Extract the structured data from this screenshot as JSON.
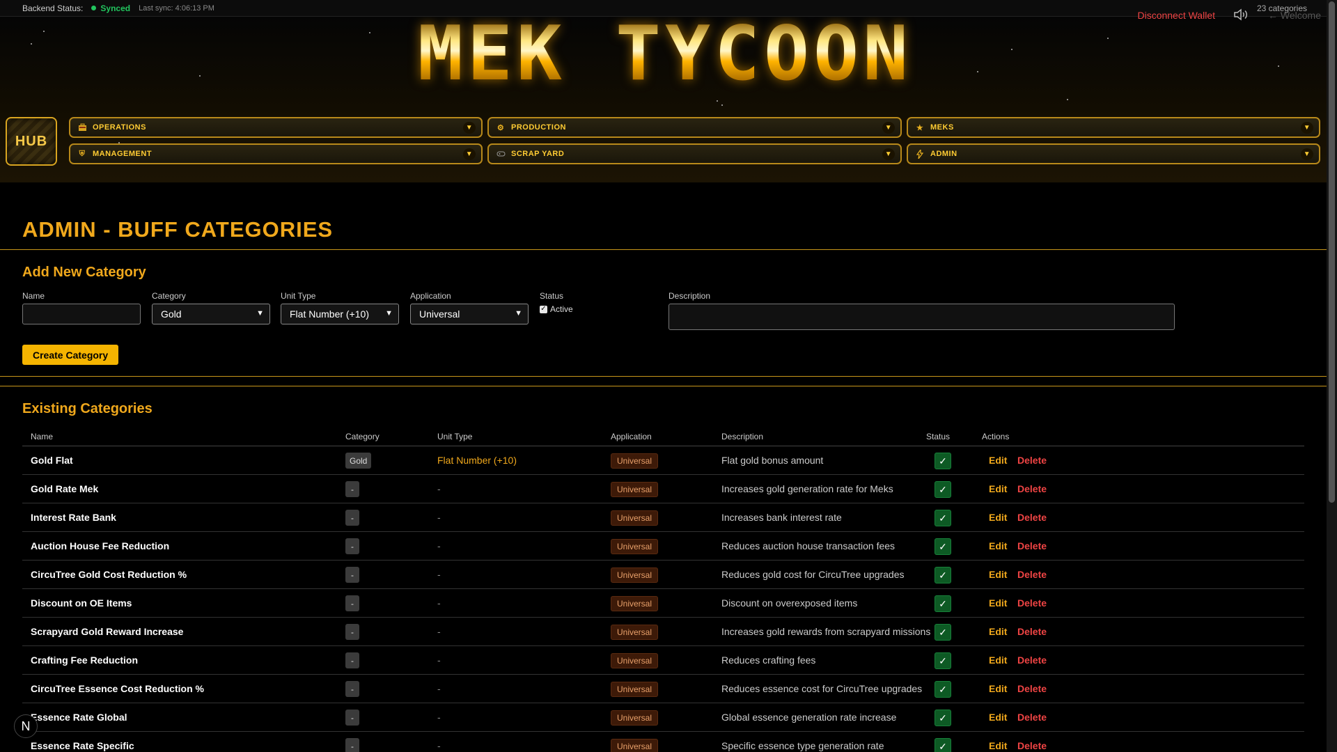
{
  "status_bar": {
    "label": "Backend Status:",
    "status": "Synced",
    "last_sync": "Last sync: 4:06:13 PM"
  },
  "top_right": {
    "disconnect_label": "Disconnect Wallet",
    "welcome_label": "← Welcome",
    "category_count": "23 categories"
  },
  "header": {
    "logo_text": "MEK TYCOON"
  },
  "nav": {
    "hub_label": "HUB",
    "items": [
      {
        "label": "OPERATIONS",
        "icon": "briefcase-icon"
      },
      {
        "label": "PRODUCTION",
        "icon": "gear-icon"
      },
      {
        "label": "MEKS",
        "icon": "star-icon"
      },
      {
        "label": "MANAGEMENT",
        "icon": "shield-icon"
      },
      {
        "label": "SCRAP YARD",
        "icon": "gamepad-icon"
      },
      {
        "label": "ADMIN",
        "icon": "bolt-icon"
      }
    ]
  },
  "page": {
    "title": "ADMIN - BUFF CATEGORIES"
  },
  "form": {
    "title": "Add New Category",
    "name_label": "Name",
    "name_value": "",
    "category_label": "Category",
    "category_value": "Gold",
    "unit_type_label": "Unit Type",
    "unit_type_value": "Flat Number (+10)",
    "application_label": "Application",
    "application_value": "Universal",
    "status_label": "Status",
    "active_label": "Active",
    "active_checked": true,
    "description_label": "Description",
    "description_value": "",
    "create_button": "Create Category"
  },
  "table": {
    "title": "Existing Categories",
    "columns": [
      "Name",
      "Category",
      "Unit Type",
      "Application",
      "Description",
      "Status",
      "Actions"
    ],
    "edit_label": "Edit",
    "delete_label": "Delete",
    "rows": [
      {
        "name": "Gold Flat",
        "category": "Gold",
        "unit_type": "Flat Number (+10)",
        "application": "Universal",
        "description": "Flat gold bonus amount",
        "status": "✓"
      },
      {
        "name": "Gold Rate Mek",
        "category": "-",
        "unit_type": "-",
        "application": "Universal",
        "description": "Increases gold generation rate for Meks",
        "status": "✓"
      },
      {
        "name": "Interest Rate Bank",
        "category": "-",
        "unit_type": "-",
        "application": "Universal",
        "description": "Increases bank interest rate",
        "status": "✓"
      },
      {
        "name": "Auction House Fee Reduction",
        "category": "-",
        "unit_type": "-",
        "application": "Universal",
        "description": "Reduces auction house transaction fees",
        "status": "✓"
      },
      {
        "name": "CircuTree Gold Cost Reduction %",
        "category": "-",
        "unit_type": "-",
        "application": "Universal",
        "description": "Reduces gold cost for CircuTree upgrades",
        "status": "✓"
      },
      {
        "name": "Discount on OE Items",
        "category": "-",
        "unit_type": "-",
        "application": "Universal",
        "description": "Discount on overexposed items",
        "status": "✓"
      },
      {
        "name": "Scrapyard Gold Reward Increase",
        "category": "-",
        "unit_type": "-",
        "application": "Universal",
        "description": "Increases gold rewards from scrapyard missions",
        "status": "✓"
      },
      {
        "name": "Crafting Fee Reduction",
        "category": "-",
        "unit_type": "-",
        "application": "Universal",
        "description": "Reduces crafting fees",
        "status": "✓"
      },
      {
        "name": "CircuTree Essence Cost Reduction %",
        "category": "-",
        "unit_type": "-",
        "application": "Universal",
        "description": "Reduces essence cost for CircuTree upgrades",
        "status": "✓"
      },
      {
        "name": "Essence Rate Global",
        "category": "-",
        "unit_type": "-",
        "application": "Universal",
        "description": "Global essence generation rate increase",
        "status": "✓"
      },
      {
        "name": "Essence Rate Specific",
        "category": "-",
        "unit_type": "-",
        "application": "Universal",
        "description": "Specific essence type generation rate",
        "status": "✓"
      }
    ]
  },
  "corner_badge": "N",
  "colors": {
    "accent_gold": "#f0a81c",
    "synced_green": "#22c55e",
    "danger_red": "#ef4444"
  }
}
